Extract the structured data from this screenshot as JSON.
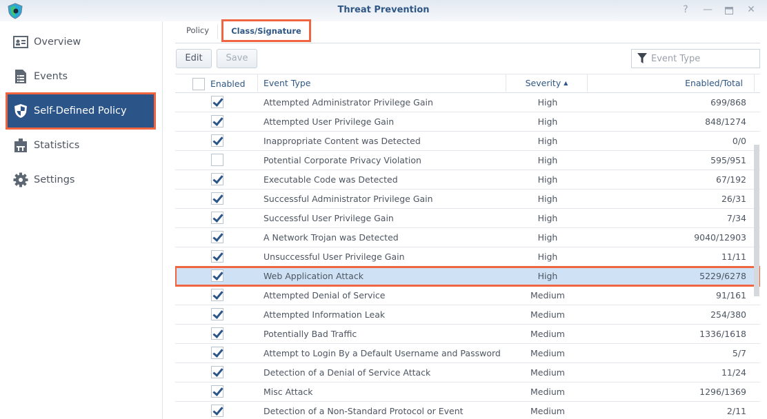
{
  "window": {
    "title": "Threat Prevention",
    "controls": [
      "help",
      "minimize",
      "maximize",
      "close"
    ]
  },
  "sidebar": {
    "items": [
      {
        "label": "Overview",
        "icon": "overview-card-icon",
        "active": false
      },
      {
        "label": "Events",
        "icon": "events-list-icon",
        "active": false
      },
      {
        "label": "Self-Defined Policy",
        "icon": "shield-icon",
        "active": true
      },
      {
        "label": "Statistics",
        "icon": "statistics-icon",
        "active": false
      },
      {
        "label": "Settings",
        "icon": "gear-icon",
        "active": false
      }
    ]
  },
  "tabs": [
    {
      "label": "Policy",
      "active": false
    },
    {
      "label": "Class/Signature",
      "active": true
    }
  ],
  "toolbar": {
    "edit_label": "Edit",
    "save_label": "Save",
    "filter_placeholder": "Event Type"
  },
  "table": {
    "columns": {
      "enabled": "Enabled",
      "event_type": "Event Type",
      "severity": "Severity",
      "severity_sort": "ascending",
      "enabled_total": "Enabled/Total"
    },
    "rows": [
      {
        "enabled": true,
        "event_type": "Attempted Administrator Privilege Gain",
        "severity": "High",
        "enabled_total": "699/868"
      },
      {
        "enabled": true,
        "event_type": "Attempted User Privilege Gain",
        "severity": "High",
        "enabled_total": "848/1274"
      },
      {
        "enabled": true,
        "event_type": "Inappropriate Content was Detected",
        "severity": "High",
        "enabled_total": "0/0"
      },
      {
        "enabled": false,
        "event_type": "Potential Corporate Privacy Violation",
        "severity": "High",
        "enabled_total": "595/951"
      },
      {
        "enabled": true,
        "event_type": "Executable Code was Detected",
        "severity": "High",
        "enabled_total": "67/192"
      },
      {
        "enabled": true,
        "event_type": "Successful Administrator Privilege Gain",
        "severity": "High",
        "enabled_total": "26/31"
      },
      {
        "enabled": true,
        "event_type": "Successful User Privilege Gain",
        "severity": "High",
        "enabled_total": "7/34"
      },
      {
        "enabled": true,
        "event_type": "A Network Trojan was Detected",
        "severity": "High",
        "enabled_total": "9040/12903"
      },
      {
        "enabled": true,
        "event_type": "Unsuccessful User Privilege Gain",
        "severity": "High",
        "enabled_total": "11/11"
      },
      {
        "enabled": true,
        "event_type": "Web Application Attack",
        "severity": "High",
        "enabled_total": "5229/6278",
        "selected": true
      },
      {
        "enabled": true,
        "event_type": "Attempted Denial of Service",
        "severity": "Medium",
        "enabled_total": "91/161"
      },
      {
        "enabled": true,
        "event_type": "Attempted Information Leak",
        "severity": "Medium",
        "enabled_total": "254/380"
      },
      {
        "enabled": true,
        "event_type": "Potentially Bad Traffic",
        "severity": "Medium",
        "enabled_total": "1336/1618"
      },
      {
        "enabled": true,
        "event_type": "Attempt to Login By a Default Username and Password",
        "severity": "Medium",
        "enabled_total": "5/7"
      },
      {
        "enabled": true,
        "event_type": "Detection of a Denial of Service Attack",
        "severity": "Medium",
        "enabled_total": "11/24"
      },
      {
        "enabled": true,
        "event_type": "Misc Attack",
        "severity": "Medium",
        "enabled_total": "1296/1369"
      },
      {
        "enabled": true,
        "event_type": "Detection of a Non-Standard Protocol or Event",
        "severity": "Medium",
        "enabled_total": "2/11"
      }
    ]
  },
  "colors": {
    "accent": "#2b5588",
    "highlight_border": "#f0643f",
    "selected_row": "#cfe2f5"
  }
}
